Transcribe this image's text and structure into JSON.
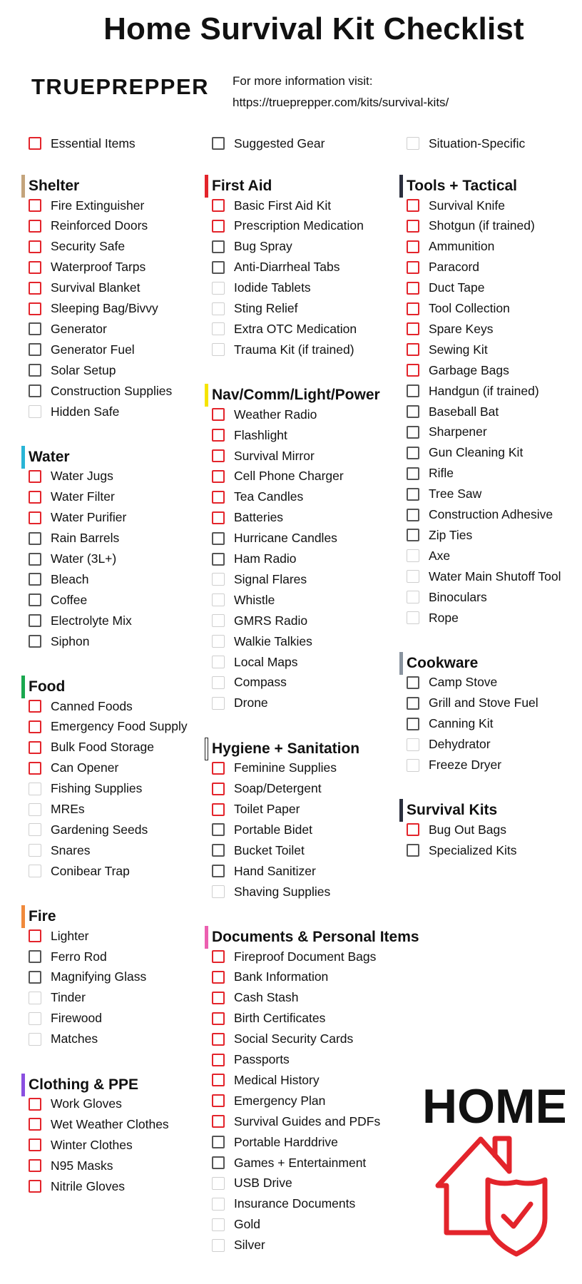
{
  "title": "Home Survival Kit Checklist",
  "brand": "TRUEPREPPER",
  "info_line1": "For more information visit:",
  "info_line2": "https://trueprepper.com/kits/survival-kits/",
  "legend": {
    "essential": "Essential Items",
    "suggested": "Suggested Gear",
    "situational": "Situation-Specific"
  },
  "colors": {
    "essential_box": "#e3242b",
    "suggested_box": "#555555",
    "situational_box": "#cfcfcf",
    "logo": "#e3242b"
  },
  "logo_text": "HOME",
  "columns": [
    {
      "sections": [
        {
          "title": "Shelter",
          "color": "#c4a47c",
          "items": [
            {
              "label": "Fire Extinguisher",
              "level": "essential"
            },
            {
              "label": "Reinforced Doors",
              "level": "essential"
            },
            {
              "label": "Security Safe",
              "level": "essential"
            },
            {
              "label": "Waterproof Tarps",
              "level": "essential"
            },
            {
              "label": "Survival Blanket",
              "level": "essential"
            },
            {
              "label": "Sleeping Bag/Bivvy",
              "level": "essential"
            },
            {
              "label": "Generator",
              "level": "suggested"
            },
            {
              "label": "Generator Fuel",
              "level": "suggested"
            },
            {
              "label": "Solar Setup",
              "level": "suggested"
            },
            {
              "label": "Construction Supplies",
              "level": "suggested"
            },
            {
              "label": "Hidden Safe",
              "level": "situational"
            }
          ]
        },
        {
          "title": "Water",
          "color": "#29b5d6",
          "items": [
            {
              "label": "Water Jugs",
              "level": "essential"
            },
            {
              "label": "Water Filter",
              "level": "essential"
            },
            {
              "label": "Water Purifier",
              "level": "essential"
            },
            {
              "label": "Rain Barrels",
              "level": "suggested"
            },
            {
              "label": "Water (3L+)",
              "level": "suggested"
            },
            {
              "label": "Bleach",
              "level": "suggested"
            },
            {
              "label": "Coffee",
              "level": "suggested"
            },
            {
              "label": "Electrolyte Mix",
              "level": "suggested"
            },
            {
              "label": "Siphon",
              "level": "suggested"
            }
          ]
        },
        {
          "title": "Food",
          "color": "#1aa84f",
          "items": [
            {
              "label": "Canned Foods",
              "level": "essential"
            },
            {
              "label": "Emergency Food Supply",
              "level": "essential"
            },
            {
              "label": "Bulk Food Storage",
              "level": "essential"
            },
            {
              "label": "Can Opener",
              "level": "essential"
            },
            {
              "label": "Fishing Supplies",
              "level": "situational"
            },
            {
              "label": "MREs",
              "level": "situational"
            },
            {
              "label": "Gardening Seeds",
              "level": "situational"
            },
            {
              "label": "Snares",
              "level": "situational"
            },
            {
              "label": "Conibear Trap",
              "level": "situational"
            }
          ]
        },
        {
          "title": "Fire",
          "color": "#f08a3c",
          "items": [
            {
              "label": "Lighter",
              "level": "essential"
            },
            {
              "label": "Ferro Rod",
              "level": "suggested"
            },
            {
              "label": "Magnifying Glass",
              "level": "suggested"
            },
            {
              "label": "Tinder",
              "level": "situational"
            },
            {
              "label": "Firewood",
              "level": "situational"
            },
            {
              "label": "Matches",
              "level": "situational"
            }
          ]
        },
        {
          "title": "Clothing & PPE",
          "color": "#8a4fe0",
          "items": [
            {
              "label": "Work Gloves",
              "level": "essential"
            },
            {
              "label": "Wet Weather Clothes",
              "level": "essential"
            },
            {
              "label": "Winter Clothes",
              "level": "essential"
            },
            {
              "label": "N95 Masks",
              "level": "essential"
            },
            {
              "label": "Nitrile Gloves",
              "level": "essential"
            }
          ]
        }
      ]
    },
    {
      "sections": [
        {
          "title": "First Aid",
          "color": "#e3242b",
          "items": [
            {
              "label": "Basic First Aid Kit",
              "level": "essential"
            },
            {
              "label": "Prescription Medication",
              "level": "essential"
            },
            {
              "label": "Bug Spray",
              "level": "suggested"
            },
            {
              "label": "Anti-Diarrheal Tabs",
              "level": "suggested"
            },
            {
              "label": "Iodide Tablets",
              "level": "situational"
            },
            {
              "label": "Sting Relief",
              "level": "situational"
            },
            {
              "label": "Extra OTC Medication",
              "level": "situational"
            },
            {
              "label": "Trauma Kit (if trained)",
              "level": "situational"
            }
          ]
        },
        {
          "title": "Nav/Comm/Light/Power",
          "color": "#f5e400",
          "items": [
            {
              "label": "Weather Radio",
              "level": "essential"
            },
            {
              "label": "Flashlight",
              "level": "essential"
            },
            {
              "label": "Survival Mirror",
              "level": "essential"
            },
            {
              "label": "Cell Phone Charger",
              "level": "essential"
            },
            {
              "label": "Tea Candles",
              "level": "essential"
            },
            {
              "label": "Batteries",
              "level": "essential"
            },
            {
              "label": "Hurricane Candles",
              "level": "suggested"
            },
            {
              "label": "Ham Radio",
              "level": "suggested"
            },
            {
              "label": "Signal Flares",
              "level": "situational"
            },
            {
              "label": "Whistle",
              "level": "situational"
            },
            {
              "label": "GMRS Radio",
              "level": "situational"
            },
            {
              "label": "Walkie Talkies",
              "level": "situational"
            },
            {
              "label": "Local Maps",
              "level": "situational"
            },
            {
              "label": "Compass",
              "level": "situational"
            },
            {
              "label": "Drone",
              "level": "situational"
            }
          ]
        },
        {
          "title": "Hygiene + Sanitation",
          "color": "#ffffff",
          "items": [
            {
              "label": "Feminine Supplies",
              "level": "essential"
            },
            {
              "label": "Soap/Detergent",
              "level": "essential"
            },
            {
              "label": "Toilet Paper",
              "level": "essential"
            },
            {
              "label": "Portable Bidet",
              "level": "suggested"
            },
            {
              "label": "Bucket Toilet",
              "level": "suggested"
            },
            {
              "label": "Hand Sanitizer",
              "level": "suggested"
            },
            {
              "label": "Shaving Supplies",
              "level": "situational"
            }
          ]
        },
        {
          "title": "Documents & Personal Items",
          "color": "#ec5fb0",
          "items": [
            {
              "label": "Fireproof Document Bags",
              "level": "essential"
            },
            {
              "label": "Bank Information",
              "level": "essential"
            },
            {
              "label": "Cash Stash",
              "level": "essential"
            },
            {
              "label": "Birth Certificates",
              "level": "essential"
            },
            {
              "label": "Social Security Cards",
              "level": "essential"
            },
            {
              "label": "Passports",
              "level": "essential"
            },
            {
              "label": "Medical History",
              "level": "essential"
            },
            {
              "label": "Emergency Plan",
              "level": "essential"
            },
            {
              "label": "Survival Guides and PDFs",
              "level": "essential"
            },
            {
              "label": "Portable Harddrive",
              "level": "suggested"
            },
            {
              "label": "Games + Entertainment",
              "level": "suggested"
            },
            {
              "label": "USB Drive",
              "level": "situational"
            },
            {
              "label": "Insurance Documents",
              "level": "situational"
            },
            {
              "label": "Gold",
              "level": "situational"
            },
            {
              "label": "Silver",
              "level": "situational"
            }
          ]
        }
      ]
    },
    {
      "sections": [
        {
          "title": "Tools + Tactical",
          "color": "#2b2f3e",
          "items": [
            {
              "label": "Survival Knife",
              "level": "essential"
            },
            {
              "label": "Shotgun (if trained)",
              "level": "essential"
            },
            {
              "label": "Ammunition",
              "level": "essential"
            },
            {
              "label": "Paracord",
              "level": "essential"
            },
            {
              "label": "Duct Tape",
              "level": "essential"
            },
            {
              "label": "Tool Collection",
              "level": "essential"
            },
            {
              "label": "Spare Keys",
              "level": "essential"
            },
            {
              "label": "Sewing Kit",
              "level": "essential"
            },
            {
              "label": "Garbage Bags",
              "level": "essential"
            },
            {
              "label": "Handgun (if trained)",
              "level": "suggested"
            },
            {
              "label": "Baseball Bat",
              "level": "suggested"
            },
            {
              "label": "Sharpener",
              "level": "suggested"
            },
            {
              "label": "Gun Cleaning Kit",
              "level": "suggested"
            },
            {
              "label": "Rifle",
              "level": "suggested"
            },
            {
              "label": "Tree Saw",
              "level": "suggested"
            },
            {
              "label": "Construction Adhesive",
              "level": "suggested"
            },
            {
              "label": "Zip Ties",
              "level": "suggested"
            },
            {
              "label": "Axe",
              "level": "situational"
            },
            {
              "label": "Water Main Shutoff Tool",
              "level": "situational"
            },
            {
              "label": "Binoculars",
              "level": "situational"
            },
            {
              "label": "Rope",
              "level": "situational"
            }
          ]
        },
        {
          "title": "Cookware",
          "color": "#8a94a0",
          "items": [
            {
              "label": "Camp Stove",
              "level": "suggested"
            },
            {
              "label": "Grill and Stove Fuel",
              "level": "suggested"
            },
            {
              "label": "Canning Kit",
              "level": "suggested"
            },
            {
              "label": "Dehydrator",
              "level": "situational"
            },
            {
              "label": "Freeze Dryer",
              "level": "situational"
            }
          ]
        },
        {
          "title": "Survival Kits",
          "color": "#2b2f3e",
          "items": [
            {
              "label": "Bug Out Bags",
              "level": "essential"
            },
            {
              "label": "Specialized Kits",
              "level": "suggested"
            }
          ]
        }
      ]
    }
  ]
}
